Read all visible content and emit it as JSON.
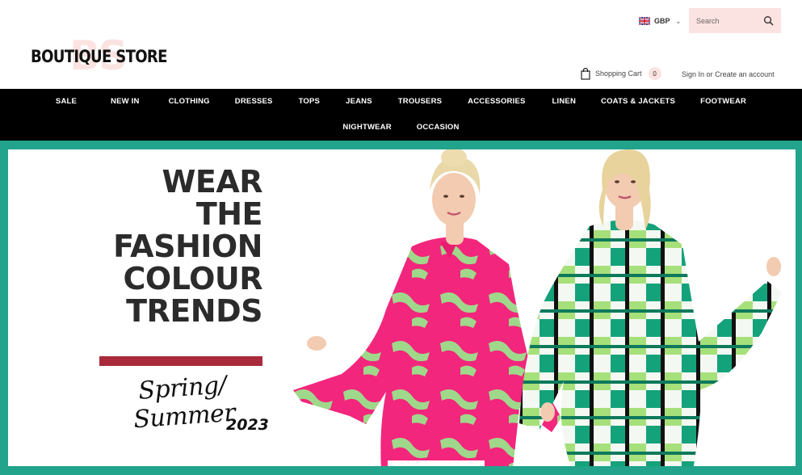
{
  "header": {
    "logo_monogram": "BS",
    "logo_text": "BOUTIQUE STORE",
    "currency": "GBP",
    "search": {
      "placeholder": "Search"
    },
    "cart": {
      "label": "Shopping Cart",
      "count": "0"
    },
    "account": {
      "sign_in": "Sign In",
      "or": "or",
      "create": "Create an account"
    }
  },
  "nav": {
    "row1": [
      "SALE",
      "NEW IN",
      "CLOTHING",
      "DRESSES",
      "TOPS",
      "JEANS",
      "TROUSERS",
      "ACCESSORIES",
      "LINEN",
      "COATS & JACKETS",
      "FOOTWEAR"
    ],
    "row2": [
      "NIGHTWEAR",
      "OCCASION"
    ]
  },
  "hero": {
    "headline": [
      "WEAR",
      "THE",
      "FASHION",
      "COLOUR",
      "TRENDS"
    ],
    "season": "Spring/ Summer",
    "year": "2023"
  },
  "colors": {
    "accent_pink": "#fbe3e1",
    "hero_border": "#22a38c",
    "red_bar": "#a92b3b",
    "nav_bg": "#000000"
  }
}
